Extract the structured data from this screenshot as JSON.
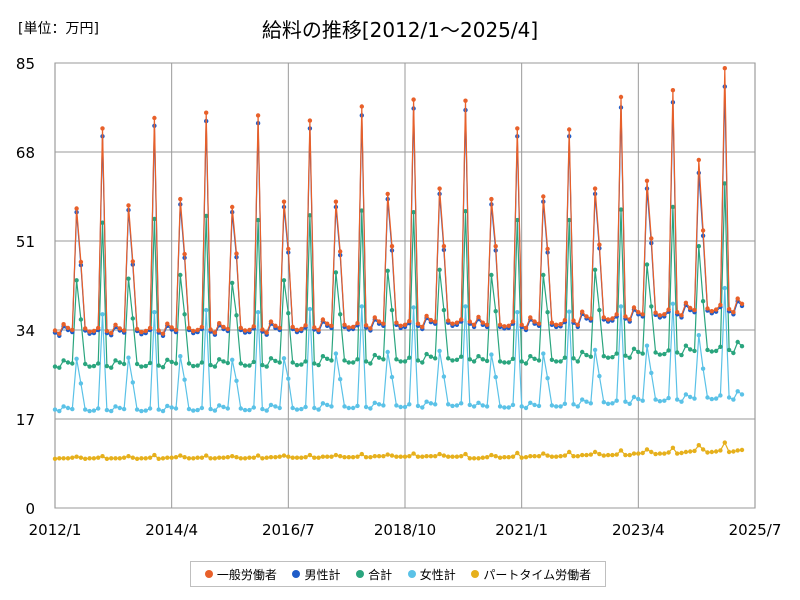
{
  "chart_data": {
    "type": "line",
    "title": "給料の推移[2012/1～2025/4]",
    "unit_label": "[単位：万円]",
    "ylim": [
      0,
      85
    ],
    "yticks": [
      "0",
      "17",
      "34",
      "51",
      "68",
      "85"
    ],
    "x_tick_labels": [
      "2012/1",
      "2014/4",
      "2016/7",
      "2018/10",
      "2021/1",
      "2023/4",
      "2025/7"
    ],
    "grid": true,
    "legend_position": "bottom",
    "series": [
      {
        "name": "一般労働者",
        "color": "#e8602a",
        "values": [
          33.9,
          33.3,
          35.1,
          34.4,
          34.0,
          57.2,
          47.0,
          34.3,
          33.7,
          33.8,
          34.4,
          72.5,
          33.8,
          33.4,
          35.0,
          34.3,
          33.9,
          57.8,
          47.1,
          34.2,
          33.6,
          33.8,
          34.4,
          74.5,
          33.9,
          33.3,
          35.2,
          34.5,
          34.0,
          59.0,
          48.5,
          34.4,
          33.8,
          34.0,
          34.6,
          75.5,
          34.1,
          33.5,
          35.3,
          34.6,
          34.2,
          57.5,
          48.6,
          34.4,
          33.9,
          34.0,
          34.7,
          75.0,
          34.1,
          33.5,
          35.6,
          34.8,
          34.4,
          58.5,
          49.5,
          34.6,
          34.0,
          34.2,
          34.9,
          74.0,
          34.5,
          34.0,
          36.0,
          35.2,
          34.8,
          58.5,
          49.0,
          35.0,
          34.5,
          34.6,
          35.3,
          76.7,
          34.9,
          34.3,
          36.4,
          35.6,
          35.2,
          60.0,
          50.0,
          35.4,
          34.8,
          35.0,
          35.7,
          78.0,
          35.2,
          34.6,
          36.7,
          35.9,
          35.6,
          61.0,
          50.0,
          35.8,
          35.2,
          35.4,
          36.0,
          77.8,
          35.6,
          35.0,
          36.5,
          35.4,
          35.0,
          59.0,
          50.0,
          35.0,
          34.7,
          34.8,
          35.6,
          72.5,
          35.0,
          34.4,
          36.4,
          35.6,
          35.2,
          59.5,
          49.5,
          35.4,
          35.0,
          35.1,
          35.9,
          72.3,
          35.8,
          35.0,
          37.5,
          36.6,
          36.2,
          61.0,
          50.3,
          36.4,
          36.0,
          36.2,
          37.0,
          78.5,
          36.6,
          36.0,
          38.3,
          37.4,
          37.0,
          62.5,
          51.5,
          37.3,
          36.8,
          37.0,
          37.9,
          79.8,
          37.4,
          36.8,
          39.2,
          38.2,
          37.8,
          66.5,
          53.0,
          38.1,
          37.6,
          37.9,
          38.8,
          84.0,
          38.0,
          37.4,
          40.0,
          39.0
        ]
      },
      {
        "name": "男性計",
        "color": "#1f5cc8",
        "values": [
          33.5,
          32.9,
          34.7,
          34.0,
          33.6,
          56.5,
          46.4,
          33.9,
          33.3,
          33.4,
          34.0,
          71.0,
          33.4,
          33.0,
          34.6,
          33.9,
          33.5,
          56.9,
          46.5,
          33.8,
          33.2,
          33.4,
          34.0,
          73.0,
          33.5,
          32.9,
          34.8,
          34.1,
          33.6,
          58.0,
          47.8,
          34.0,
          33.4,
          33.6,
          34.2,
          73.9,
          33.7,
          33.1,
          34.9,
          34.2,
          33.8,
          56.5,
          47.9,
          34.0,
          33.5,
          33.6,
          34.3,
          73.5,
          33.7,
          33.1,
          35.2,
          34.4,
          34.0,
          57.5,
          48.8,
          34.2,
          33.6,
          33.8,
          34.5,
          72.5,
          34.1,
          33.6,
          35.6,
          34.8,
          34.4,
          57.5,
          48.3,
          34.6,
          34.1,
          34.2,
          34.9,
          75.0,
          34.5,
          33.9,
          36.0,
          35.2,
          34.8,
          59.0,
          49.2,
          35.0,
          34.4,
          34.6,
          35.3,
          76.3,
          34.8,
          34.2,
          36.3,
          35.5,
          35.2,
          60.0,
          49.3,
          35.4,
          34.8,
          35.0,
          35.6,
          76.0,
          35.2,
          34.6,
          36.1,
          35.0,
          34.6,
          58.0,
          49.2,
          34.6,
          34.3,
          34.4,
          35.2,
          71.0,
          34.6,
          34.0,
          36.0,
          35.2,
          34.8,
          58.5,
          48.8,
          35.0,
          34.6,
          34.7,
          35.5,
          71.0,
          35.4,
          34.6,
          37.1,
          36.2,
          35.8,
          60.0,
          49.6,
          36.0,
          35.6,
          35.8,
          36.6,
          76.5,
          36.2,
          35.6,
          37.9,
          37.0,
          36.6,
          61.0,
          50.6,
          36.9,
          36.4,
          36.6,
          37.5,
          77.5,
          37.0,
          36.4,
          38.8,
          37.8,
          37.4,
          64.0,
          52.0,
          37.7,
          37.2,
          37.5,
          38.4,
          80.5,
          37.6,
          37.0,
          39.5,
          38.6
        ]
      },
      {
        "name": "合計",
        "color": "#2aa57e",
        "values": [
          27.0,
          26.8,
          28.2,
          27.8,
          27.6,
          43.5,
          36.0,
          27.5,
          27.0,
          27.1,
          27.6,
          54.5,
          27.1,
          26.8,
          28.2,
          27.8,
          27.5,
          43.8,
          36.2,
          27.5,
          27.0,
          27.1,
          27.7,
          55.2,
          27.2,
          26.9,
          28.3,
          27.9,
          27.6,
          44.5,
          37.0,
          27.6,
          27.1,
          27.2,
          27.8,
          55.8,
          27.3,
          27.0,
          28.4,
          28.0,
          27.7,
          43.0,
          36.8,
          27.6,
          27.2,
          27.2,
          27.9,
          55.0,
          27.3,
          27.0,
          28.6,
          28.1,
          27.8,
          43.5,
          37.2,
          27.8,
          27.3,
          27.4,
          28.0,
          55.9,
          27.6,
          27.3,
          29.0,
          28.5,
          28.2,
          45.0,
          37.0,
          28.2,
          27.8,
          27.8,
          28.4,
          56.8,
          28.0,
          27.6,
          29.2,
          28.7,
          28.4,
          45.3,
          37.8,
          28.4,
          28.0,
          28.0,
          28.7,
          56.5,
          28.2,
          27.8,
          29.4,
          28.9,
          28.6,
          45.5,
          37.8,
          28.6,
          28.2,
          28.3,
          28.9,
          56.7,
          28.4,
          28.0,
          29.0,
          28.4,
          28.1,
          44.5,
          37.6,
          28.0,
          27.8,
          27.8,
          28.5,
          55.0,
          28.0,
          27.6,
          29.0,
          28.5,
          28.2,
          44.5,
          37.4,
          28.3,
          28.0,
          28.0,
          28.7,
          55.0,
          28.6,
          28.0,
          29.8,
          29.2,
          28.9,
          45.5,
          37.8,
          29.0,
          28.7,
          28.8,
          29.5,
          57.0,
          29.1,
          28.7,
          30.4,
          29.8,
          29.5,
          46.5,
          38.5,
          29.7,
          29.3,
          29.4,
          30.1,
          57.5,
          29.7,
          29.2,
          31.0,
          30.3,
          30.0,
          50.0,
          39.5,
          30.2,
          29.9,
          30.0,
          30.8,
          62.0,
          30.2,
          29.6,
          31.7,
          30.9
        ]
      },
      {
        "name": "女性計",
        "color": "#5bc2e7",
        "values": [
          18.8,
          18.5,
          19.4,
          19.1,
          18.9,
          28.5,
          23.8,
          18.8,
          18.5,
          18.6,
          19.0,
          37.0,
          18.7,
          18.5,
          19.4,
          19.1,
          18.9,
          28.7,
          24.0,
          18.8,
          18.5,
          18.6,
          19.0,
          37.4,
          18.8,
          18.5,
          19.5,
          19.2,
          19.0,
          29.0,
          24.5,
          18.9,
          18.6,
          18.7,
          19.1,
          37.8,
          18.9,
          18.6,
          19.6,
          19.3,
          19.0,
          28.3,
          24.3,
          19.0,
          18.7,
          18.7,
          19.2,
          37.4,
          18.9,
          18.6,
          19.7,
          19.4,
          19.1,
          28.6,
          24.7,
          19.1,
          18.8,
          18.9,
          19.3,
          38.0,
          19.1,
          18.8,
          20.0,
          19.7,
          19.4,
          29.5,
          24.6,
          19.4,
          19.1,
          19.1,
          19.5,
          38.5,
          19.3,
          19.0,
          20.1,
          19.8,
          19.6,
          29.8,
          25.0,
          19.6,
          19.3,
          19.3,
          19.8,
          38.3,
          19.5,
          19.2,
          20.3,
          20.0,
          19.8,
          30.0,
          25.1,
          19.8,
          19.5,
          19.6,
          20.0,
          38.5,
          19.7,
          19.4,
          20.1,
          19.6,
          19.4,
          29.3,
          25.0,
          19.4,
          19.2,
          19.2,
          19.7,
          37.4,
          19.4,
          19.1,
          20.1,
          19.7,
          19.5,
          29.5,
          24.8,
          19.6,
          19.4,
          19.4,
          19.9,
          37.5,
          19.8,
          19.4,
          20.7,
          20.3,
          20.0,
          30.2,
          25.2,
          20.2,
          19.9,
          20.0,
          20.5,
          38.5,
          20.3,
          19.9,
          21.2,
          20.8,
          20.5,
          31.0,
          25.8,
          20.7,
          20.4,
          20.5,
          21.0,
          39.0,
          20.7,
          20.3,
          21.7,
          21.2,
          20.9,
          33.0,
          26.6,
          21.1,
          20.8,
          20.9,
          21.5,
          42.0,
          21.1,
          20.7,
          22.3,
          21.7
        ]
      },
      {
        "name": "パートタイム労働者",
        "color": "#e6b01c",
        "values": [
          9.4,
          9.5,
          9.5,
          9.5,
          9.6,
          9.8,
          9.6,
          9.4,
          9.5,
          9.5,
          9.6,
          9.9,
          9.4,
          9.5,
          9.5,
          9.5,
          9.6,
          9.9,
          9.6,
          9.4,
          9.5,
          9.5,
          9.6,
          10.1,
          9.4,
          9.5,
          9.6,
          9.6,
          9.7,
          10.0,
          9.7,
          9.5,
          9.5,
          9.6,
          9.6,
          10.0,
          9.5,
          9.5,
          9.6,
          9.6,
          9.7,
          9.9,
          9.7,
          9.5,
          9.5,
          9.6,
          9.6,
          10.0,
          9.5,
          9.6,
          9.7,
          9.7,
          9.8,
          10.0,
          9.8,
          9.6,
          9.6,
          9.6,
          9.7,
          10.1,
          9.6,
          9.6,
          9.8,
          9.8,
          9.8,
          10.1,
          9.9,
          9.7,
          9.7,
          9.7,
          9.8,
          10.3,
          9.7,
          9.7,
          9.9,
          9.9,
          9.9,
          10.2,
          10.0,
          9.8,
          9.8,
          9.8,
          9.9,
          10.4,
          9.8,
          9.8,
          9.9,
          9.9,
          9.9,
          10.3,
          10.0,
          9.8,
          9.8,
          9.8,
          9.9,
          10.3,
          9.5,
          9.5,
          9.5,
          9.6,
          9.7,
          10.1,
          9.9,
          9.6,
          9.7,
          9.7,
          9.8,
          10.5,
          9.6,
          9.7,
          9.9,
          9.9,
          9.9,
          10.4,
          10.0,
          9.8,
          9.8,
          9.9,
          10.0,
          10.7,
          9.9,
          9.9,
          10.1,
          10.1,
          10.2,
          10.7,
          10.3,
          10.0,
          10.1,
          10.1,
          10.2,
          11.0,
          10.1,
          10.1,
          10.4,
          10.4,
          10.5,
          11.2,
          10.7,
          10.3,
          10.4,
          10.4,
          10.6,
          11.5,
          10.4,
          10.5,
          10.7,
          10.8,
          10.9,
          12.0,
          11.2,
          10.6,
          10.7,
          10.8,
          11.0,
          12.5,
          10.7,
          10.8,
          11.0,
          11.1
        ]
      }
    ]
  }
}
